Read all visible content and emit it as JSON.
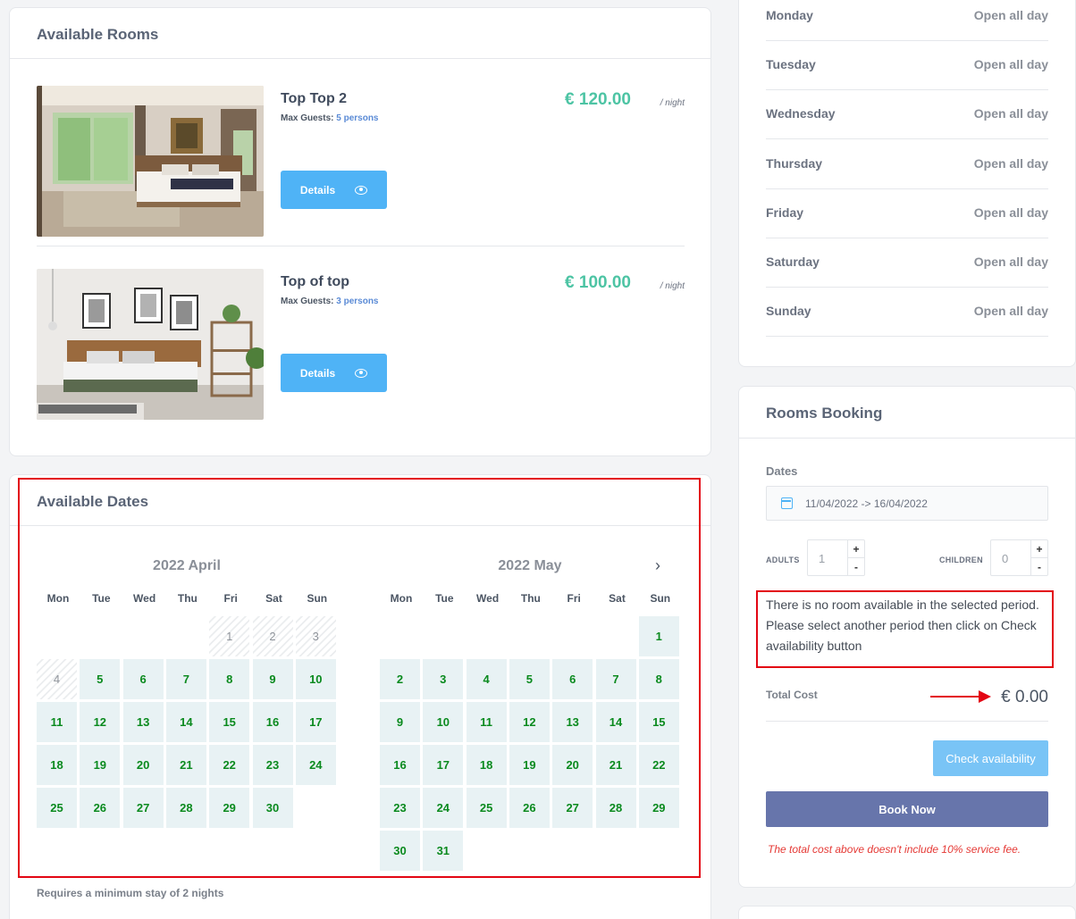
{
  "rooms": {
    "title": "Available Rooms",
    "items": [
      {
        "name": "Top Top 2",
        "guests_label": "Max Guests:",
        "guests": "5 persons",
        "price": "€ 120.00",
        "per": "/ night",
        "details": "Details"
      },
      {
        "name": "Top of top",
        "guests_label": "Max Guests:",
        "guests": "3 persons",
        "price": "€ 100.00",
        "per": "/ night",
        "details": "Details"
      }
    ]
  },
  "dates": {
    "title": "Available Dates",
    "weekdays": [
      "Mon",
      "Tue",
      "Wed",
      "Thu",
      "Fri",
      "Sat",
      "Sun"
    ],
    "months": [
      {
        "title": "2022 April",
        "first_weekday": 4,
        "days": 30,
        "unavailable_through": 4
      },
      {
        "title": "2022 May",
        "first_weekday": 6,
        "days": 31,
        "unavailable_through": 0
      }
    ],
    "min_stay": "Requires a minimum stay of 2 nights",
    "next_icon": "chevron-right-icon"
  },
  "hours": [
    {
      "day": "Monday",
      "value": "Open all day"
    },
    {
      "day": "Tuesday",
      "value": "Open all day"
    },
    {
      "day": "Wednesday",
      "value": "Open all day"
    },
    {
      "day": "Thursday",
      "value": "Open all day"
    },
    {
      "day": "Friday",
      "value": "Open all day"
    },
    {
      "day": "Saturday",
      "value": "Open all day"
    },
    {
      "day": "Sunday",
      "value": "Open all day"
    }
  ],
  "booking": {
    "title": "Rooms Booking",
    "dates_label": "Dates",
    "dates_value": "11/04/2022 -> 16/04/2022",
    "adults_label": "ADULTS",
    "adults_value": "1",
    "children_label": "CHILDREN",
    "children_value": "0",
    "plus": "+",
    "minus": "-",
    "notice": "There is no room available in the selected period. Please select another period then click on Check availability button",
    "total_label": "Total Cost",
    "total_value": "€ 0.00",
    "check_label": "Check availability",
    "book_label": "Book Now",
    "fee_note": "The total cost above doesn't include 10% service fee."
  },
  "colors": {
    "accent": "#4fb3f6",
    "price": "#4dc4a4",
    "available_day": "#0a8a1e",
    "highlight": "#e30613",
    "book": "#6775ab"
  }
}
